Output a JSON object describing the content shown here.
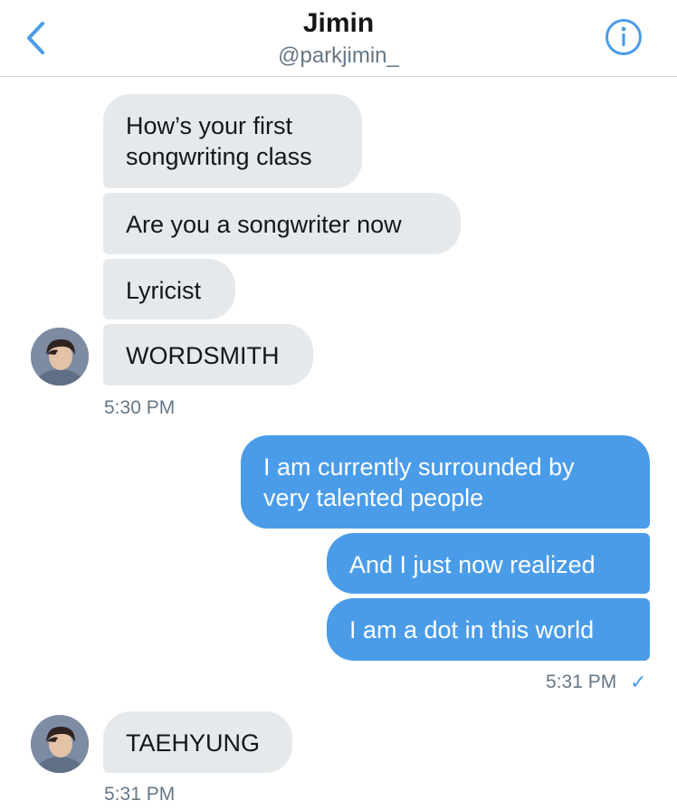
{
  "header": {
    "title": "Jimin",
    "handle": "@parkjimin_"
  },
  "colors": {
    "accent": "#4a9ce8",
    "incoming_bubble": "#e6e9ec",
    "text_primary": "#14171a",
    "text_secondary": "#657786"
  },
  "icons": {
    "back": "chevron-left-icon",
    "info": "info-circle-icon",
    "sent": "checkmark-icon"
  },
  "thread": {
    "incoming_1": [
      "How’s your first\nsongwriting class",
      "Are you a songwriter now",
      "Lyricist",
      "WORDSMITH"
    ],
    "incoming_1_time": "5:30 PM",
    "outgoing_1": [
      "I am currently surrounded by\nvery talented people",
      "And I just now realized",
      "I am a dot in this world"
    ],
    "outgoing_1_time": "5:31 PM",
    "outgoing_1_status": "✓",
    "incoming_2": [
      "TAEHYUNG"
    ],
    "incoming_2_time": "5:31 PM"
  }
}
